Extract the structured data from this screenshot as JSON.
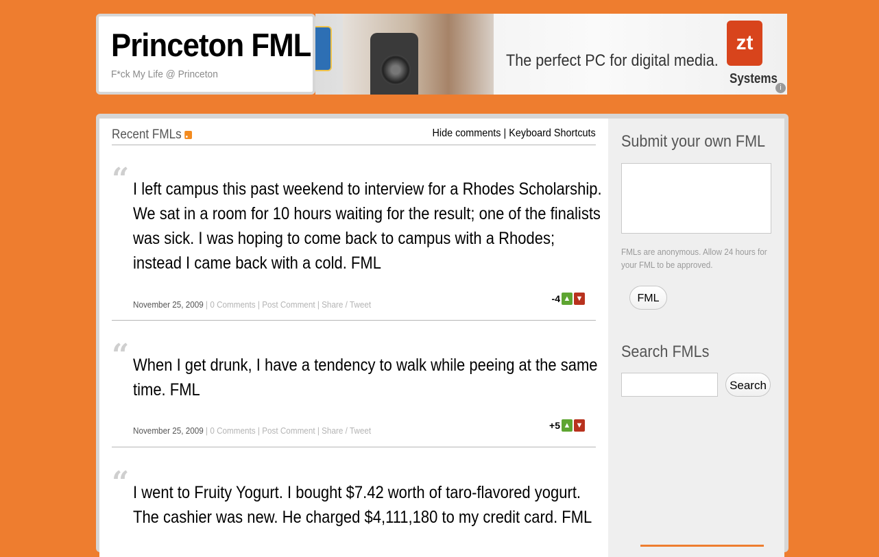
{
  "site": {
    "title": "Princeton FML",
    "tagline": "F*ck My Life @ Princeton"
  },
  "ad": {
    "tagline": "The perfect PC for digital media.",
    "logo_mark": "zt",
    "logo_text": "Systems",
    "info_glyph": "i",
    "brand_color": "#d8441c"
  },
  "feed": {
    "heading": "Recent FMLs",
    "hide_comments": "Hide comments",
    "separator": " | ",
    "keyboard_shortcuts": "Keyboard Shortcuts",
    "quote_glyph": "“",
    "posts": [
      {
        "text": "I left campus this past weekend to interview for a Rhodes Scholarship. We sat in a room for 10 hours waiting for the result; one of the finalists was sick. I was hoping to come back to campus with a Rhodes; instead I came back with a cold. FML",
        "date": "November 25, 2009",
        "comments": "0 Comments",
        "post_comment": "Post Comment",
        "share": "Share / Tweet",
        "score": "-4"
      },
      {
        "text": "When I get drunk, I have a tendency to walk while peeing at the same time. FML",
        "date": "November 25, 2009",
        "comments": "0 Comments",
        "post_comment": "Post Comment",
        "share": "Share / Tweet",
        "score": "+5"
      },
      {
        "text": "I went to Fruity Yogurt. I bought $7.42 worth of taro-flavored yogurt. The cashier was new. He charged $4,111,180 to my credit card. FML"
      }
    ]
  },
  "sidebar": {
    "submit_heading": "Submit your own FML",
    "submit_note": "FMLs are anonymous. Allow 24 hours for your FML to be approved.",
    "submit_button": "FML",
    "search_heading": "Search FMLs",
    "search_button": "Search"
  },
  "colors": {
    "background": "#ee7d2f",
    "vote_up": "#5ea531",
    "vote_down": "#b8321e"
  },
  "icons": [
    "rss-icon",
    "thumbs-up-icon",
    "thumbs-down-icon",
    "quote-icon",
    "ad-info-icon"
  ]
}
